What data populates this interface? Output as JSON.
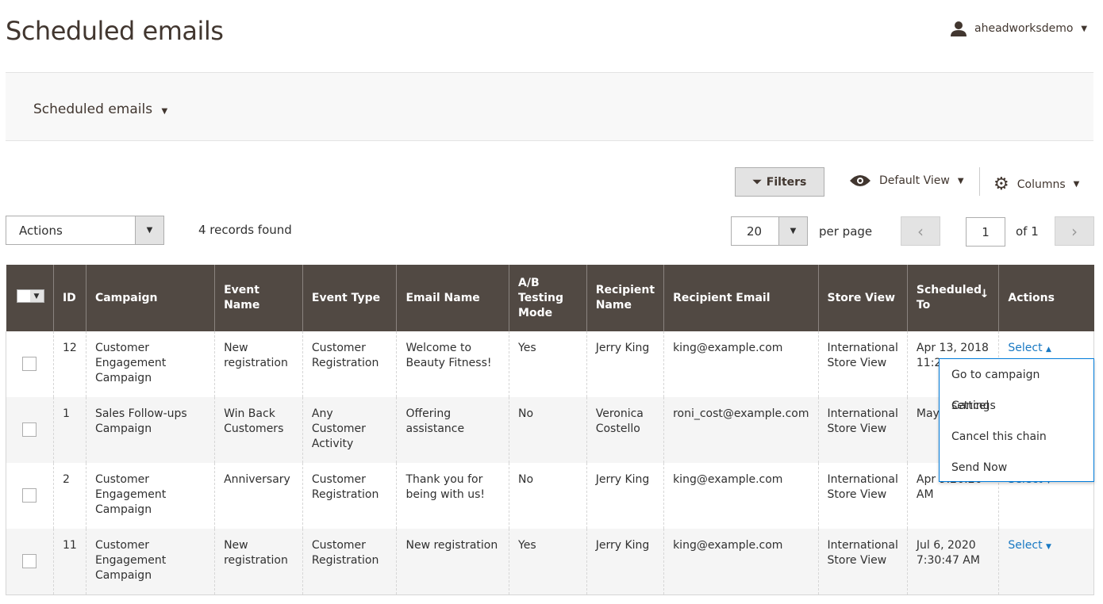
{
  "page_title": "Scheduled emails",
  "user": {
    "name": "aheadworksdemo"
  },
  "switcher": {
    "label": "Scheduled emails"
  },
  "toolbar": {
    "filters": "Filters",
    "view": "Default View",
    "columns": "Columns"
  },
  "actions_select": "Actions",
  "records": "4 records found",
  "pager": {
    "per_page_value": "20",
    "per_page_label": "per page",
    "page": "1",
    "of": "of 1"
  },
  "table": {
    "headers": [
      "ID",
      "Campaign",
      "Event Name",
      "Event Type",
      "Email Name",
      "A/B Testing Mode",
      "Recipient Name",
      "Recipient Email",
      "Store View",
      "Scheduled To",
      "Actions"
    ],
    "rows": [
      {
        "id": "12",
        "campaign": "Customer Engagement Campaign",
        "event_name": "New registration",
        "event_type": "Customer Registration",
        "email_name": "Welcome to Beauty Fitness!",
        "ab": "Yes",
        "recipient": "Jerry King",
        "email": "king@example.com",
        "store": "International Store View",
        "scheduled": "Apr 13, 2018 11:2",
        "action": "Select"
      },
      {
        "id": "1",
        "campaign": "Sales Follow-ups Campaign",
        "event_name": "Win Back Customers",
        "event_type": "Any Customer Activity",
        "email_name": "Offering assistance",
        "ab": "No",
        "recipient": "Veronica Costello",
        "email": "roni_cost@example.com",
        "store": "International Store View",
        "scheduled": "May 9:26",
        "action": "Select"
      },
      {
        "id": "2",
        "campaign": "Customer Engagement Campaign",
        "event_name": "Anniversary",
        "event_type": "Customer Registration",
        "email_name": "Thank you for being with us!",
        "ab": "No",
        "recipient": "Jerry King",
        "email": "king@example.com",
        "store": "International Store View",
        "scheduled": "Apr 9:26:26 AM",
        "action": "Select"
      },
      {
        "id": "11",
        "campaign": "Customer Engagement Campaign",
        "event_name": "New registration",
        "event_type": "Customer Registration",
        "email_name": "New registration",
        "ab": "Yes",
        "recipient": "Jerry King",
        "email": "king@example.com",
        "store": "International Store View",
        "scheduled": "Jul 6, 2020 7:30:47 AM",
        "action": "Select"
      }
    ]
  },
  "dropdown": [
    "Go to campaign settings",
    "Cancel",
    "Cancel this chain",
    "Send Now"
  ],
  "colors": {
    "header_bg": "#514943",
    "link": "#1979c3",
    "menu_border": "#007bdb"
  }
}
